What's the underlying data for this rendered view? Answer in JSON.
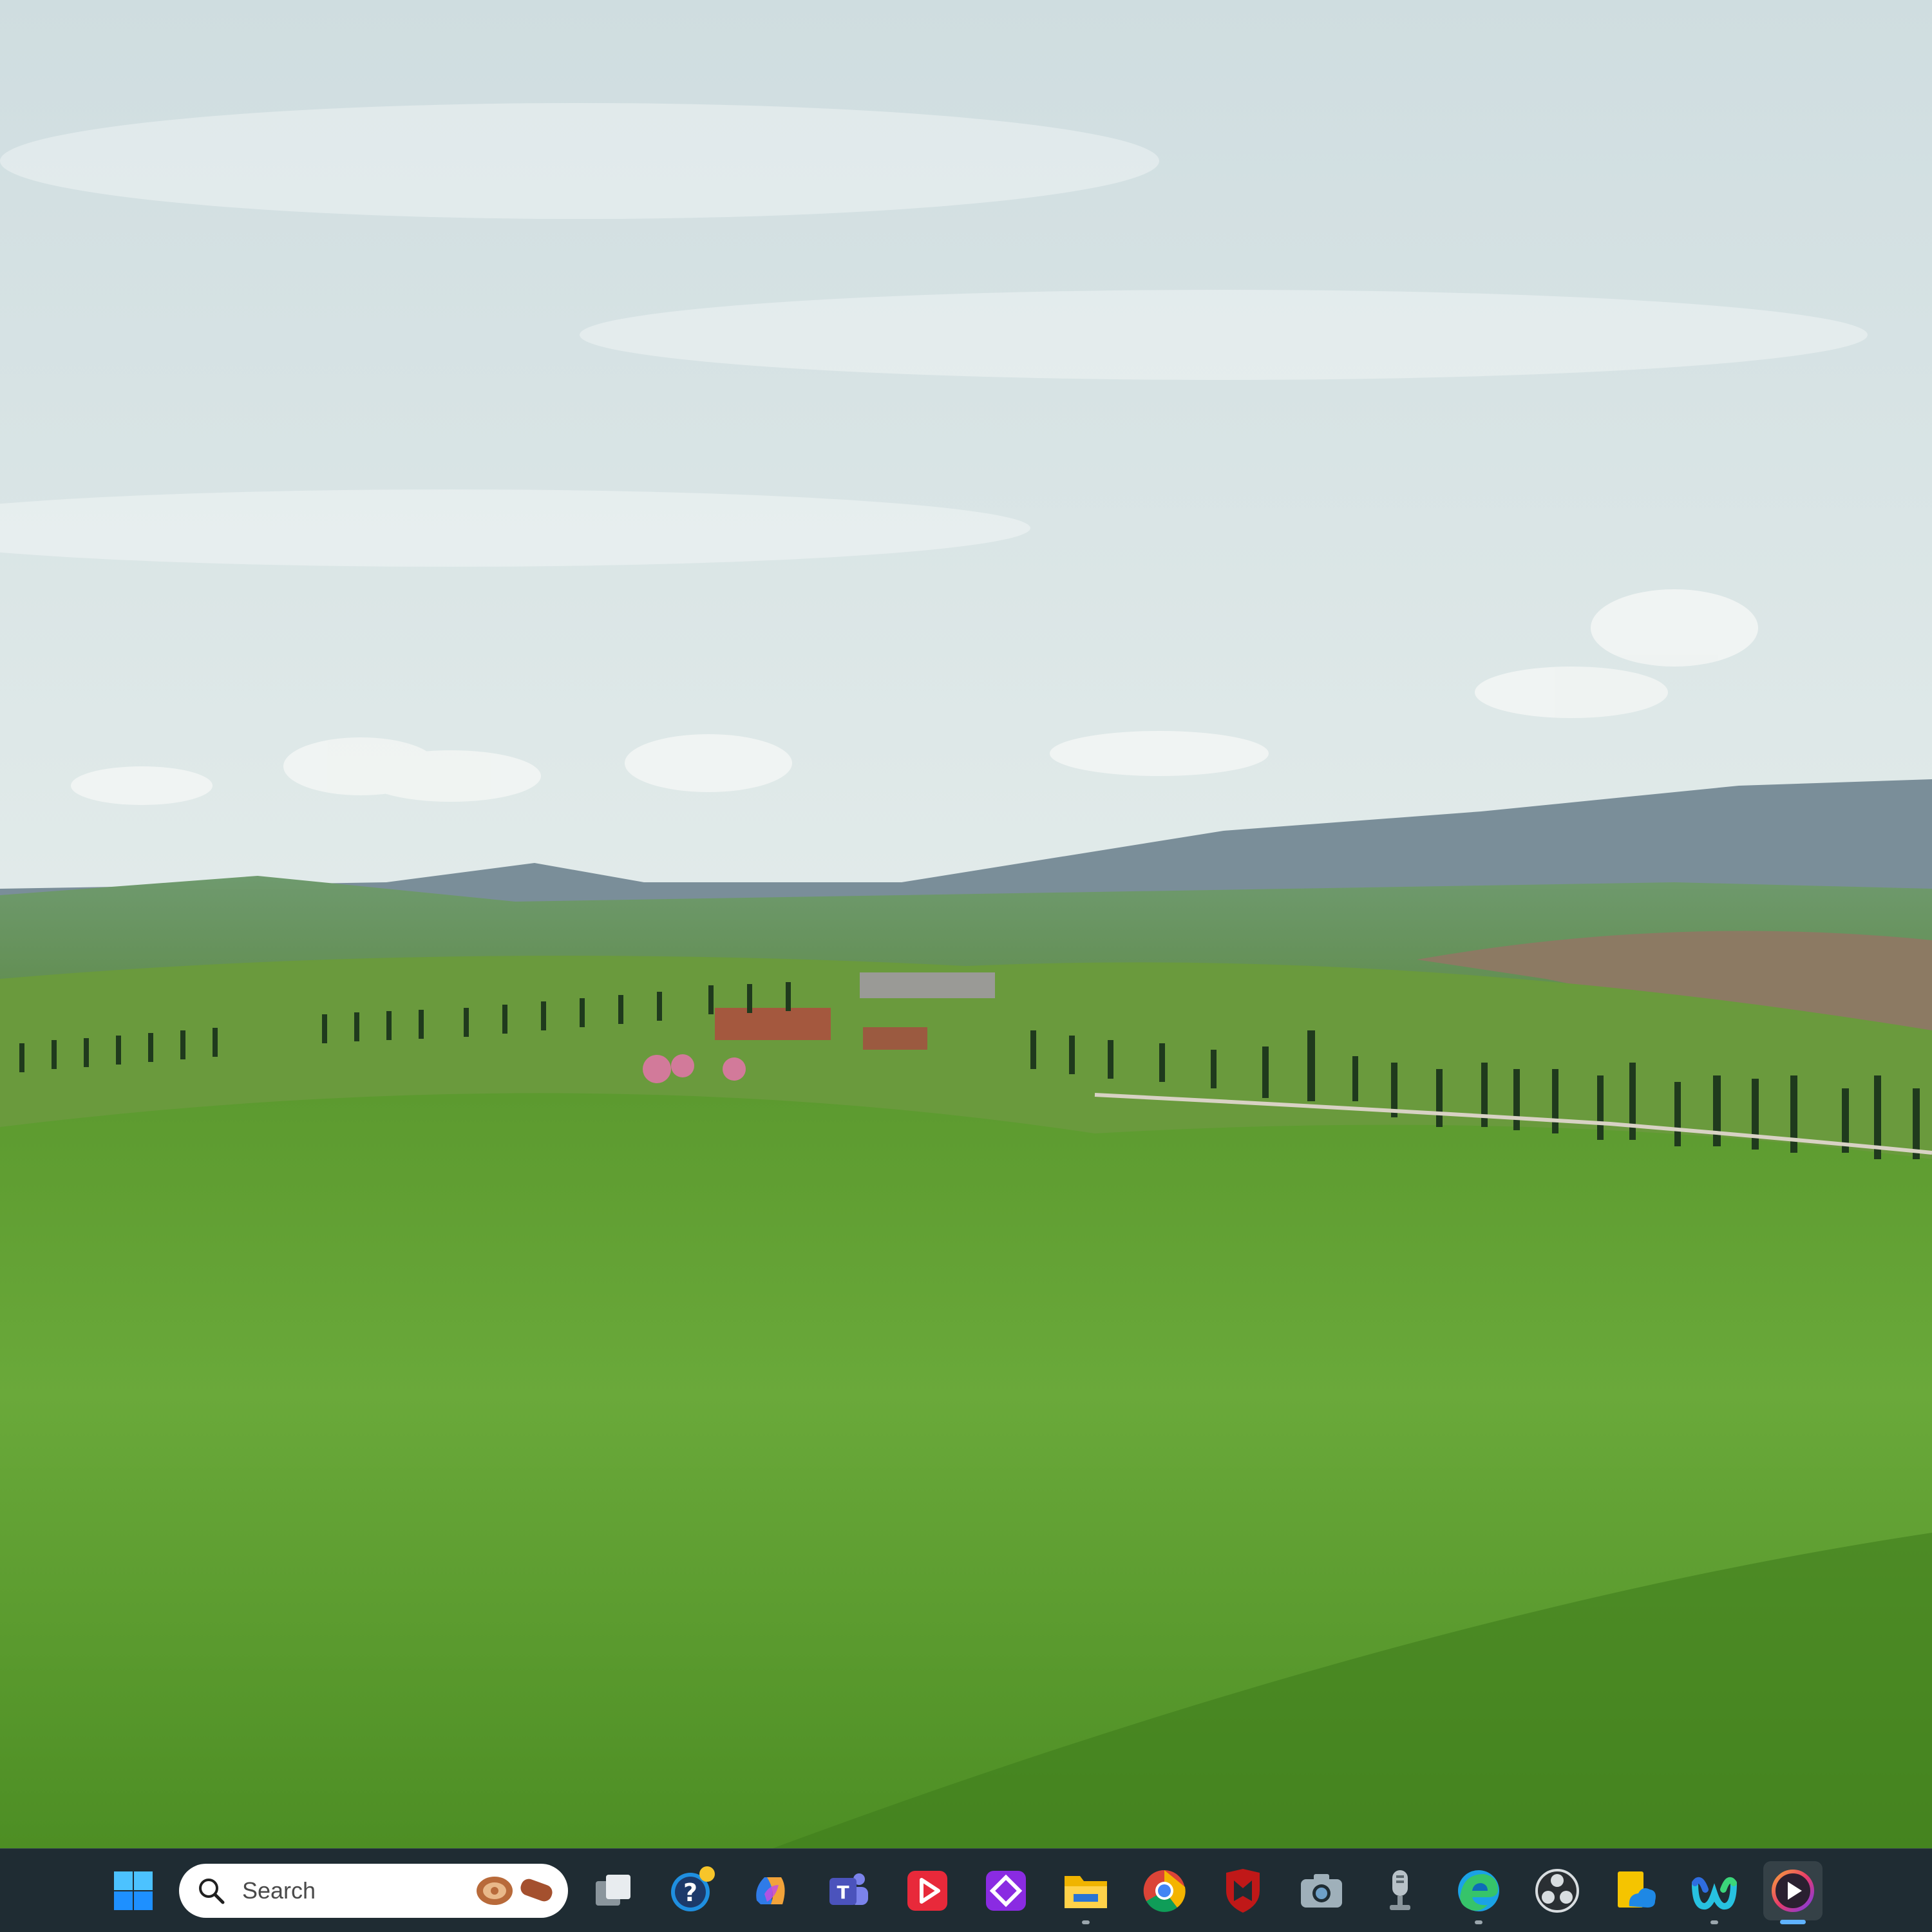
{
  "desktop": {
    "wallpaper": "tuscany-rolling-hills-cypress-landscape"
  },
  "taskbar": {
    "start_icon": "windows-logo-icon",
    "search": {
      "placeholder": "Search",
      "highlight_icon": "search-highlight-food-icon"
    },
    "apps": [
      {
        "icon": "task-view-icon",
        "running": false
      },
      {
        "icon": "get-help-icon",
        "running": false,
        "badge": true
      },
      {
        "icon": "copilot-icon",
        "running": false
      },
      {
        "icon": "teams-icon",
        "running": false
      },
      {
        "icon": "media-player-red-icon",
        "running": false
      },
      {
        "icon": "purple-diamond-app-icon",
        "running": false
      },
      {
        "icon": "file-explorer-icon",
        "running": true
      },
      {
        "icon": "chrome-icon",
        "running": false
      },
      {
        "icon": "mcafee-icon",
        "running": false
      },
      {
        "icon": "camera-icon",
        "running": false
      },
      {
        "icon": "voice-recorder-icon",
        "running": false
      },
      {
        "icon": "edge-icon",
        "running": true
      },
      {
        "icon": "obs-studio-icon",
        "running": false
      },
      {
        "icon": "onedrive-files-icon",
        "running": false
      },
      {
        "icon": "webex-icon",
        "running": true
      },
      {
        "icon": "media-player-icon",
        "running": true,
        "active": true
      }
    ],
    "colors": {
      "background": "#1f2c33",
      "accent": "#5fb2ff"
    }
  }
}
